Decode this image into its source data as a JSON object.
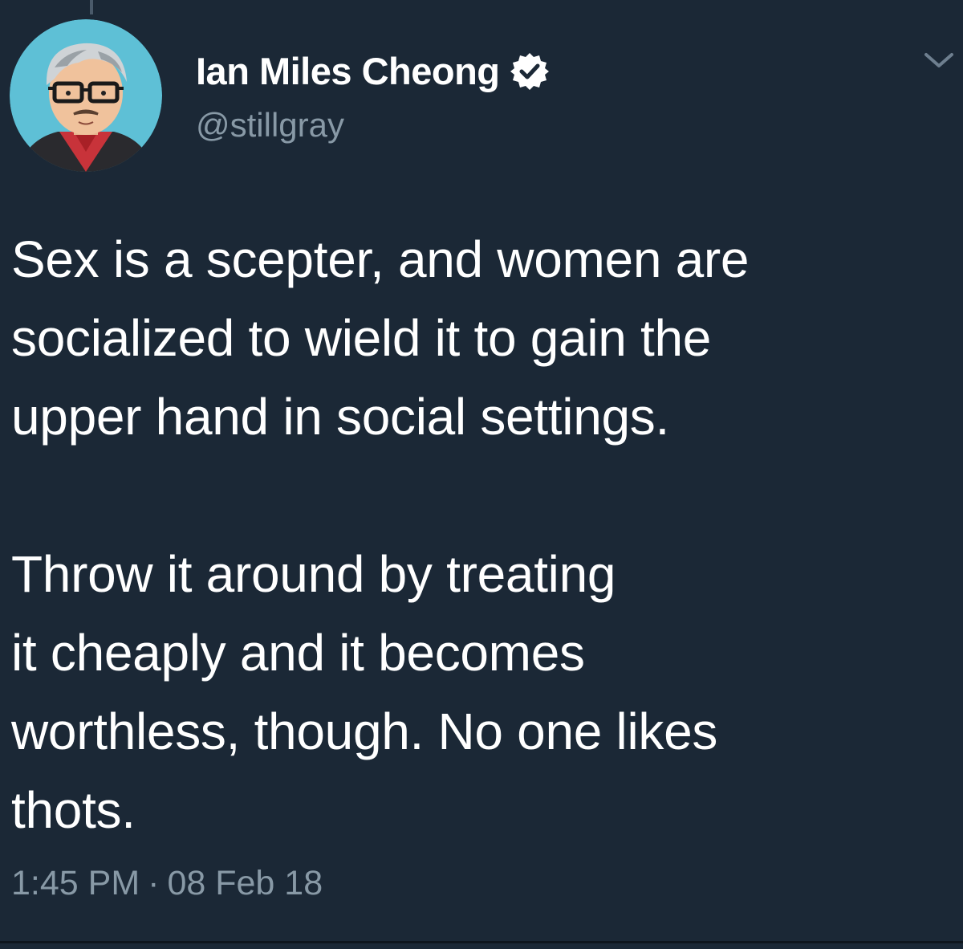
{
  "theme": {
    "background": "#1b2836",
    "text_primary": "#ffffff",
    "text_secondary": "#8899a6",
    "verified_badge_color": "#ffffff"
  },
  "author": {
    "display_name": "Ian Miles Cheong",
    "handle": "@stillgray",
    "verified": true,
    "avatar_icon": "cartoon-avatar-icon"
  },
  "tweet": {
    "paragraphs": [
      "Sex is a scepter, and women are\nsocialized to wield it to gain the\nupper hand in social settings.",
      "Throw it around by treating\nit cheaply and it becomes\nworthless, though. No one likes\nthots."
    ],
    "time": "1:45 PM",
    "separator": "·",
    "date": "08 Feb 18"
  },
  "menu": {
    "icon": "chevron-down-icon"
  }
}
